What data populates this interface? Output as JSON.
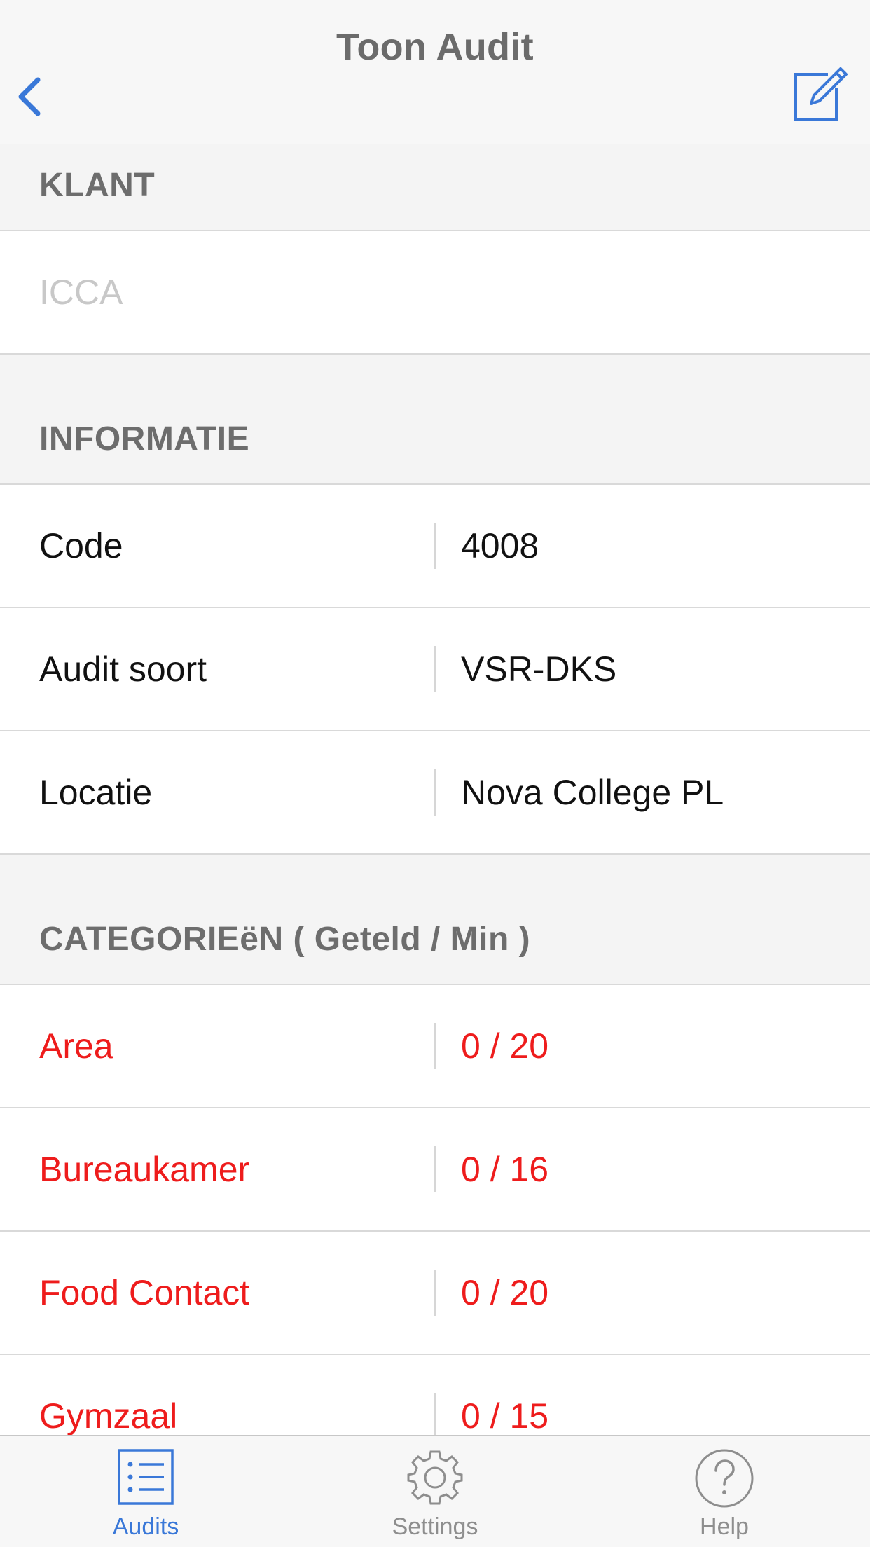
{
  "nav": {
    "title": "Toon Audit",
    "back_icon": "chevron-left-icon",
    "edit_icon": "compose-icon"
  },
  "sections": {
    "klant": {
      "header": "KLANT",
      "value": "ICCA"
    },
    "informatie": {
      "header": "INFORMATIE",
      "rows": [
        {
          "key": "Code",
          "value": "4008"
        },
        {
          "key": "Audit soort",
          "value": "VSR-DKS"
        },
        {
          "key": "Locatie",
          "value": "Nova College PL"
        }
      ]
    },
    "categorieen": {
      "header": "CATEGORIEëN ( Geteld / Min )",
      "rows": [
        {
          "key": "Area",
          "value": "0 / 20"
        },
        {
          "key": "Bureaukamer",
          "value": "0 / 16"
        },
        {
          "key": "Food Contact",
          "value": "0 / 20"
        },
        {
          "key": "Gymzaal",
          "value": "0 / 15"
        }
      ]
    }
  },
  "tabbar": {
    "items": [
      {
        "label": "Audits",
        "icon": "list-icon",
        "active": true
      },
      {
        "label": "Settings",
        "icon": "gear-icon",
        "active": false
      },
      {
        "label": "Help",
        "icon": "help-icon",
        "active": false
      }
    ]
  },
  "colors": {
    "accent": "#3a78d8",
    "warning": "#ee1c1c",
    "header_bg": "#f4f4f4",
    "muted_text": "#6d6d6d"
  }
}
